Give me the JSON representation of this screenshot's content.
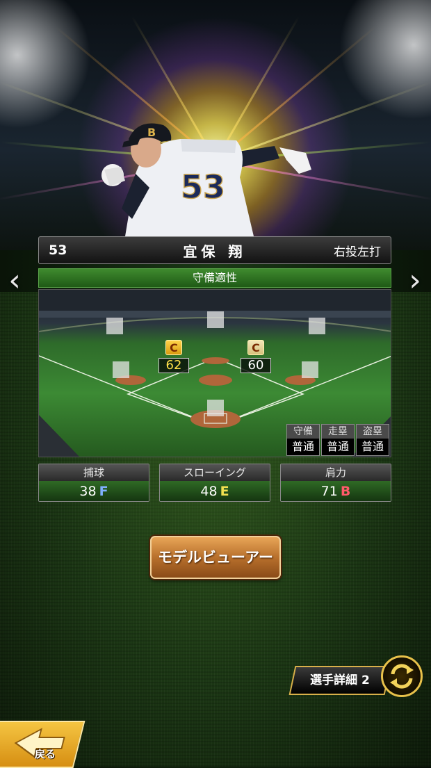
{
  "player": {
    "number": "53",
    "name": "宜保 翔",
    "handedness": "右投左打"
  },
  "section_title": "守備適性",
  "positions": {
    "second_base": {
      "grade": "C",
      "value": "62"
    },
    "shortstop": {
      "grade": "C",
      "value": "60"
    }
  },
  "speed": [
    {
      "label": "守備",
      "value": "普通"
    },
    {
      "label": "走塁",
      "value": "普通"
    },
    {
      "label": "盗塁",
      "value": "普通"
    }
  ],
  "stats": [
    {
      "label": "捕球",
      "value": "38",
      "grade": "F",
      "grade_color": "#7fb0ff"
    },
    {
      "label": "スローイング",
      "value": "48",
      "grade": "E",
      "grade_color": "#f0e050"
    },
    {
      "label": "肩力",
      "value": "71",
      "grade": "B",
      "grade_color": "#ff5a6a"
    }
  ],
  "buttons": {
    "model_viewer": "モデルビューアー",
    "player_detail": "選手詳細 2",
    "back": "戻る"
  },
  "icons": {
    "prev": "chevron-left-icon",
    "next": "chevron-right-icon",
    "swap": "swap-arrows-icon",
    "back": "back-arrow-icon"
  },
  "colors": {
    "accent_gold": "#e8c14a",
    "field_green": "#3c8a34",
    "button_orange": "#b8702c"
  }
}
